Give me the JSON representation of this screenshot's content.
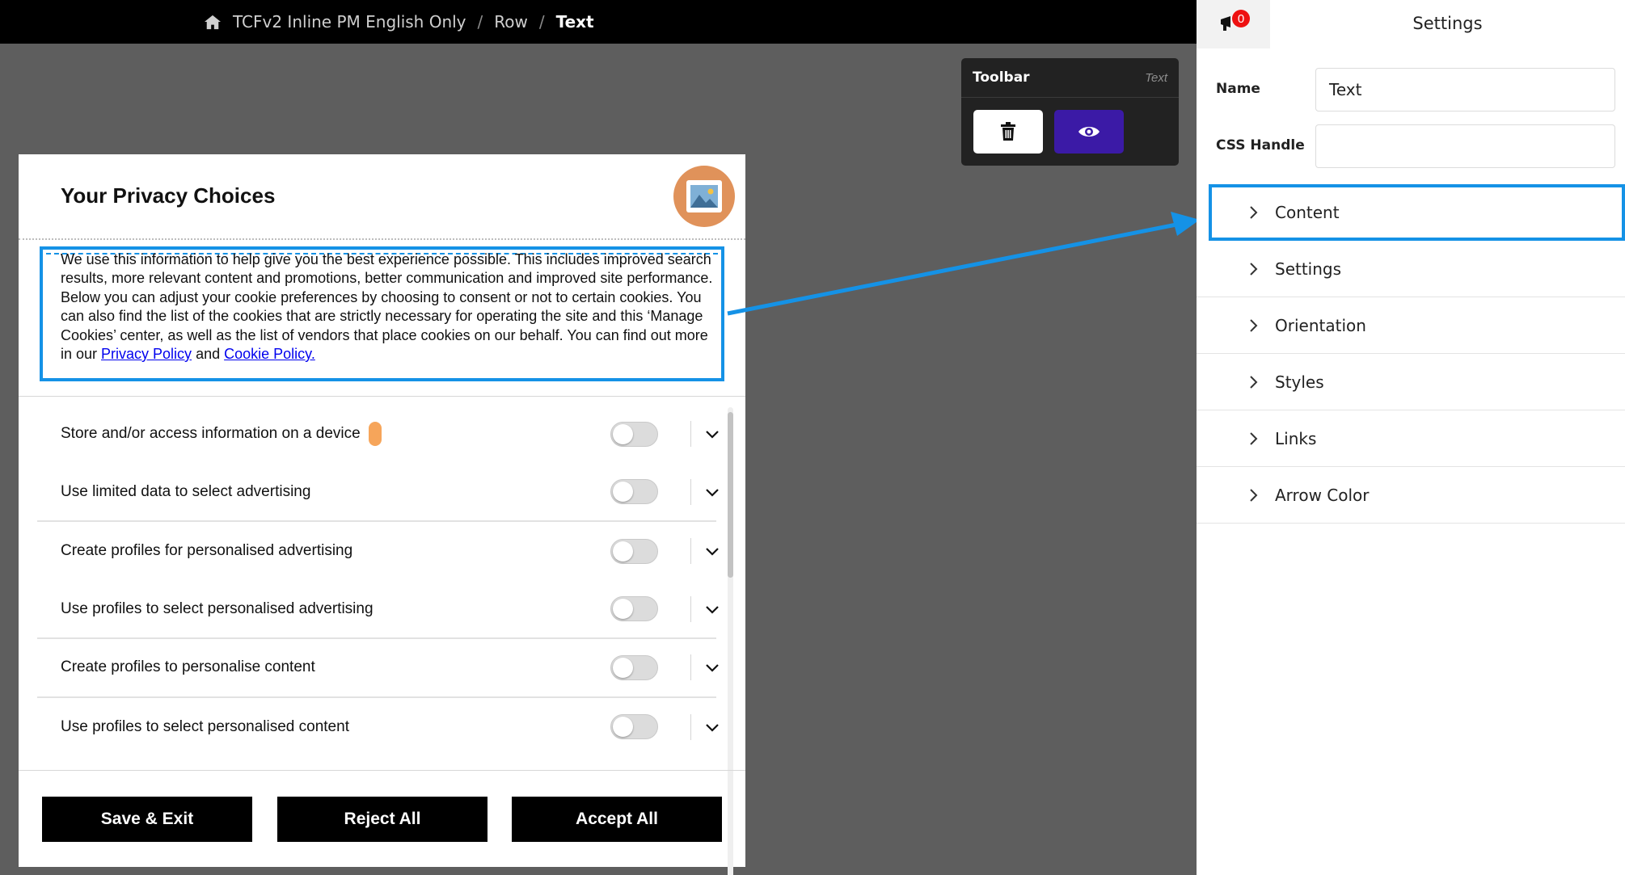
{
  "breadcrumb": {
    "home_icon": "home-icon",
    "items": [
      "TCFv2 Inline PM English Only",
      "Row",
      "Text"
    ],
    "separator": "/"
  },
  "toolbar": {
    "title": "Toolbar",
    "element_type": "Text",
    "delete_icon": "trash-icon",
    "preview_icon": "eye-icon",
    "preview_color": "#3b1aa6"
  },
  "modal": {
    "title": "Your Privacy Choices",
    "logo_icon": "image-placeholder-icon",
    "description": "We use this information to help give you the best experience possible. This includes improved search results, more relevant content and promotions, better communication and improved site performance. Below you can adjust your cookie preferences by choosing to consent or not to certain cookies. You can also find the list of the cookies that are strictly necessary for operating the site and this ‘Manage Cookies’ center, as well as the list of vendors that place cookies on our behalf. You can find out more in our ",
    "privacy_link": "Privacy Policy",
    "and_text": " and ",
    "cookie_link": "Cookie Policy.",
    "purposes": [
      {
        "label": "Store and/or access information on a device",
        "enabled": false
      },
      {
        "label": "Use limited data to select advertising",
        "enabled": false
      },
      {
        "label": "Create profiles for personalised advertising",
        "enabled": false
      },
      {
        "label": "Use profiles to select personalised advertising",
        "enabled": false
      },
      {
        "label": "Create profiles to personalise content",
        "enabled": false
      },
      {
        "label": "Use profiles to select personalised content",
        "enabled": false
      }
    ],
    "buttons": {
      "save": "Save & Exit",
      "reject": "Reject All",
      "accept": "Accept All"
    }
  },
  "panel": {
    "title": "Settings",
    "notification_count": "0",
    "name_label": "Name",
    "name_value": "Text",
    "css_label": "CSS Handle",
    "css_value": "",
    "sections": [
      "Content",
      "Settings",
      "Orientation",
      "Styles",
      "Links",
      "Arrow Color"
    ],
    "selected_section": "Content",
    "highlight_color": "#1592e6"
  }
}
